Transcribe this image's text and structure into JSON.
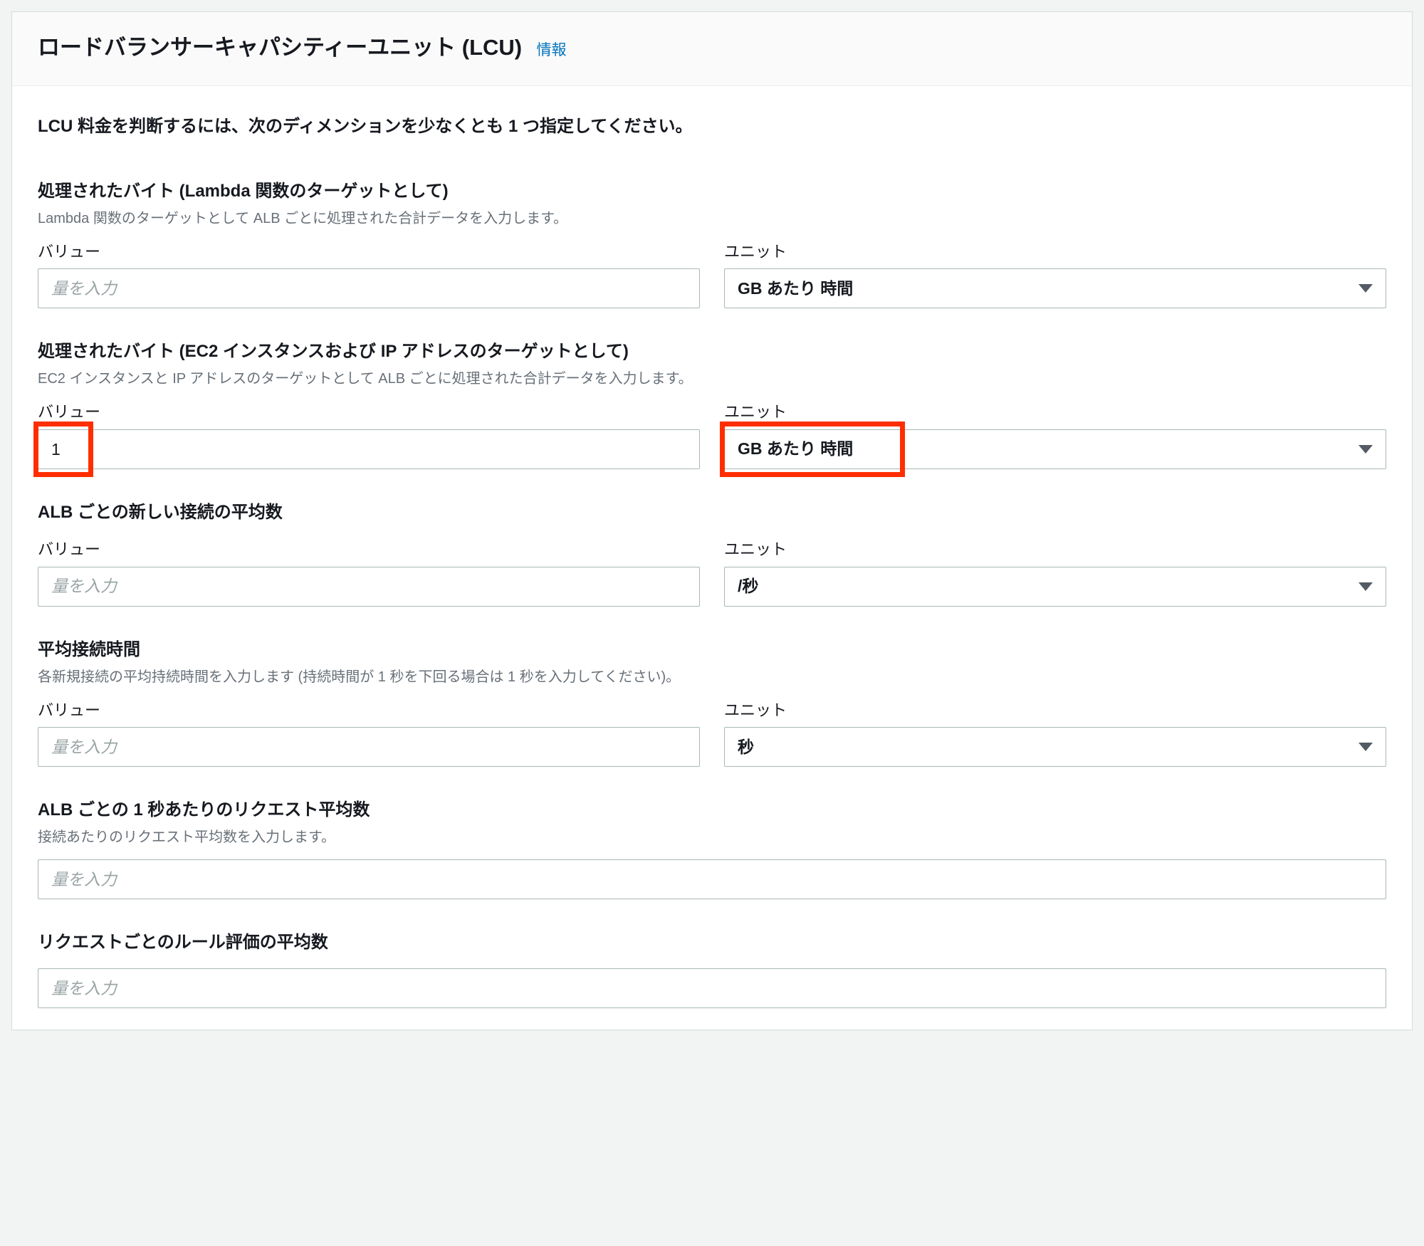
{
  "header": {
    "title": "ロードバランサーキャパシティーユニット (LCU)",
    "info": "情報"
  },
  "intro": "LCU 料金を判断するには、次のディメンションを少なくとも 1 つ指定してください。",
  "sections": {
    "lambda": {
      "title": "処理されたバイト (Lambda 関数のターゲットとして)",
      "desc": "Lambda 関数のターゲットとして ALB ごとに処理された合計データを入力します。",
      "value_label": "バリュー",
      "value_placeholder": "量を入力",
      "value": "",
      "unit_label": "ユニット",
      "unit_value": "GB あたり 時間"
    },
    "ec2": {
      "title": "処理されたバイト (EC2 インスタンスおよび IP アドレスのターゲットとして)",
      "desc": "EC2 インスタンスと IP アドレスのターゲットとして ALB ごとに処理された合計データを入力します。",
      "value_label": "バリュー",
      "value_placeholder": "量を入力",
      "value": "1",
      "unit_label": "ユニット",
      "unit_value": "GB あたり 時間"
    },
    "newconn": {
      "title": "ALB ごとの新しい接続の平均数",
      "value_label": "バリュー",
      "value_placeholder": "量を入力",
      "value": "",
      "unit_label": "ユニット",
      "unit_value": "/秒"
    },
    "duration": {
      "title": "平均接続時間",
      "desc": "各新規接続の平均持続時間を入力します (持続時間が 1 秒を下回る場合は 1 秒を入力してください)。",
      "value_label": "バリュー",
      "value_placeholder": "量を入力",
      "value": "",
      "unit_label": "ユニット",
      "unit_value": "秒"
    },
    "requests": {
      "title": "ALB ごとの 1 秒あたりのリクエスト平均数",
      "desc": "接続あたりのリクエスト平均数を入力します。",
      "value_placeholder": "量を入力",
      "value": ""
    },
    "rules": {
      "title": "リクエストごとのルール評価の平均数",
      "value_placeholder": "量を入力",
      "value": ""
    }
  }
}
